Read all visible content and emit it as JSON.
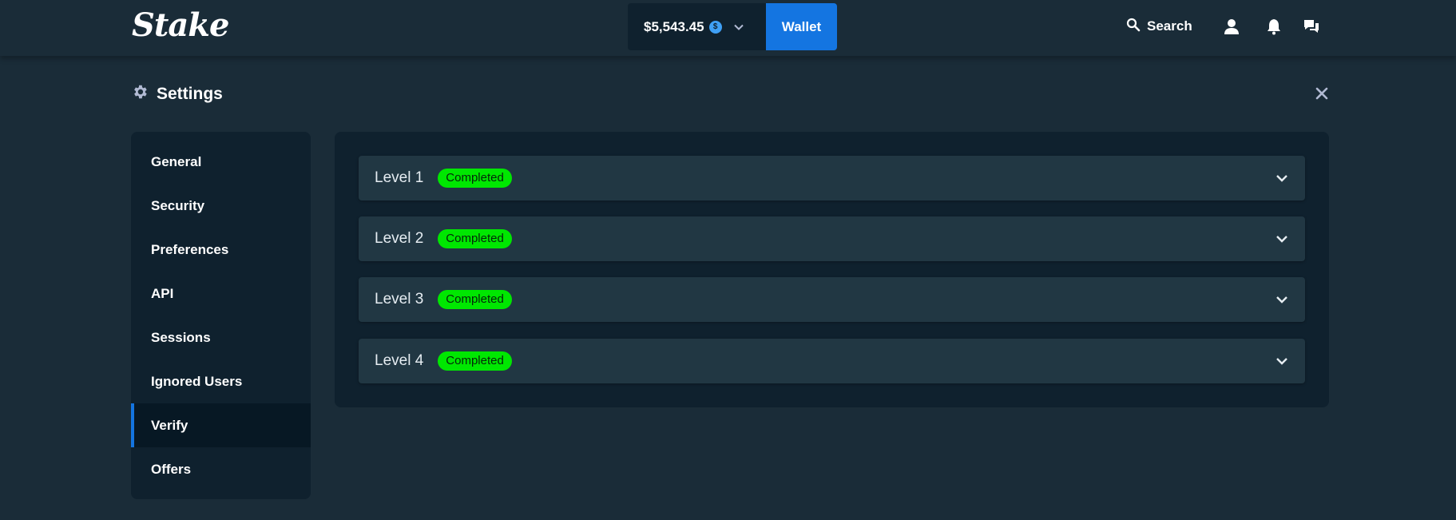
{
  "header": {
    "logo": "Stake",
    "balance": "$5,543.45",
    "coin_symbol": "$",
    "wallet_label": "Wallet",
    "search_label": "Search",
    "icons": [
      "search-icon",
      "user-icon",
      "bell-icon",
      "chat-icon"
    ]
  },
  "settings": {
    "title": "Settings",
    "icon": "gear-icon"
  },
  "sidebar": {
    "items": [
      {
        "label": "General"
      },
      {
        "label": "Security"
      },
      {
        "label": "Preferences"
      },
      {
        "label": "API"
      },
      {
        "label": "Sessions"
      },
      {
        "label": "Ignored Users"
      },
      {
        "label": "Verify",
        "active": true
      },
      {
        "label": "Offers"
      }
    ]
  },
  "levels": [
    {
      "label": "Level 1",
      "status": "Completed"
    },
    {
      "label": "Level 2",
      "status": "Completed"
    },
    {
      "label": "Level 3",
      "status": "Completed"
    },
    {
      "label": "Level 4",
      "status": "Completed"
    }
  ],
  "colors": {
    "background": "#1a2c38",
    "panel": "#0f212e",
    "row": "#213743",
    "accent": "#1475e1",
    "badge": "#00e701"
  }
}
